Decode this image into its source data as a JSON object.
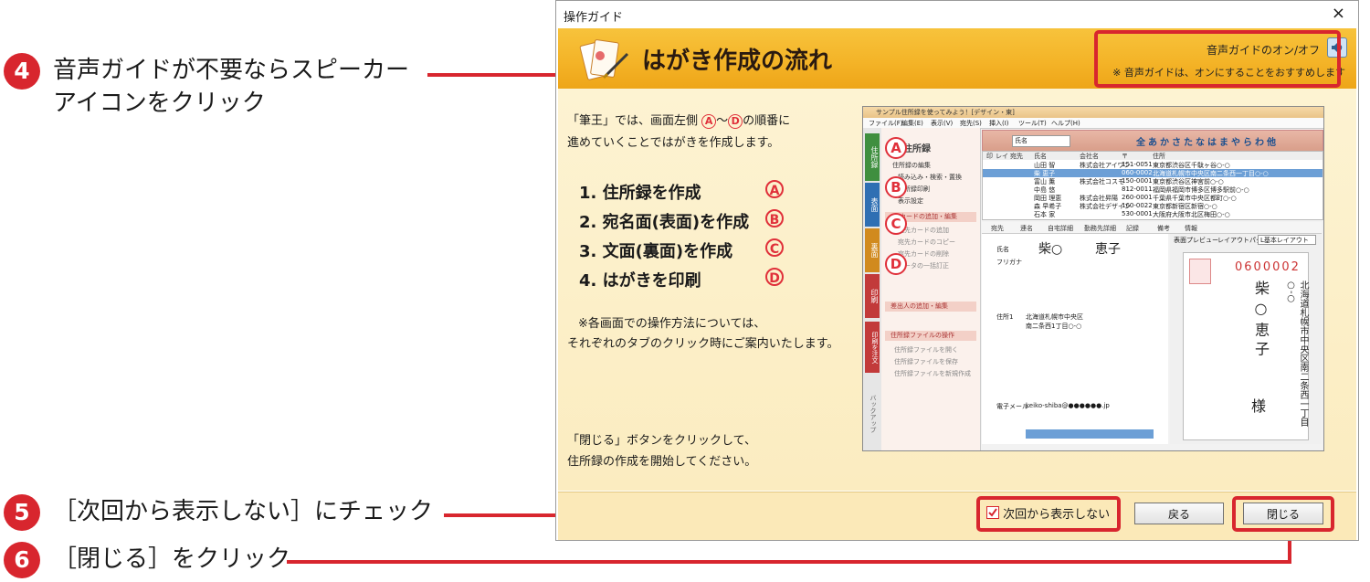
{
  "annotations": {
    "a4": {
      "num": "4",
      "line1": "音声ガイドが不要ならスピーカー",
      "line2": "アイコンをクリック"
    },
    "a5": {
      "num": "5",
      "text": "［次回から表示しない］にチェック"
    },
    "a6": {
      "num": "6",
      "text": "［閉じる］をクリック"
    }
  },
  "dialog": {
    "title": "操作ガイド",
    "close_glyph": "×",
    "banner_title": "はがき作成の流れ",
    "voice": {
      "label": "音声ガイドのオン/オフ",
      "note": "※ 音声ガイドは、オンにすることをおすすめします"
    },
    "intro": {
      "pre": "「筆王」では、画面左側",
      "a": "A",
      "tilde": "～",
      "d": "D",
      "post": "の順番に",
      "line2": "進めていくことではがきを作成します。"
    },
    "steps": [
      {
        "text": "1. 住所録を作成",
        "letter": "A"
      },
      {
        "text": "2. 宛名面(表面)を作成",
        "letter": "B"
      },
      {
        "text": "3. 文面(裏面)を作成",
        "letter": "C"
      },
      {
        "text": "4. はがきを印刷",
        "letter": "D"
      }
    ],
    "note1": "※各画面での操作方法については、",
    "note2": "それぞれのタブのクリック時にご案内いたします。",
    "closing1": "「閉じる」ボタンをクリックして、",
    "closing2": "住所録の作成を開始してください。",
    "checkbox_label": "次回から表示しない",
    "checkbox_checked": true,
    "back_button": "戻る",
    "close_button": "閉じる"
  },
  "screenshot": {
    "title": "サンプル住所録を使ってみよう！[デザイン・東]",
    "menu": [
      "ファイル(F)",
      "編集(E)",
      "表示(V)",
      "宛先(S)",
      "挿入(I)",
      "ツール(T)",
      "ヘルプ(H)"
    ],
    "side_tabs": [
      "住所録",
      "表面",
      "裏面",
      "印刷",
      "印刷を注文"
    ],
    "side_bottom": "バックアップ",
    "panel_title": "住所録",
    "panel_items": [
      {
        "letter": "A",
        "label": "住所録の編集"
      },
      {
        "letter": "B",
        "label": "読み込み・検索・置換"
      },
      {
        "letter": "",
        "label": "住所録印刷"
      },
      {
        "letter": "",
        "label": "表示設定"
      },
      {
        "letter": "C",
        "label": "カードの追加・編集"
      },
      {
        "letter": "",
        "label": "宛先カードの追加"
      },
      {
        "letter": "",
        "label": "宛先カードのコピー"
      },
      {
        "letter": "D",
        "label": "宛先カードの削除"
      },
      {
        "letter": "",
        "label": "データの一括訂正"
      },
      {
        "letter": "",
        "label": "差出人の追加・編集"
      },
      {
        "letter": "",
        "label": "住所録ファイルの操作"
      },
      {
        "letter": "",
        "label": "住所録ファイルを開く"
      },
      {
        "letter": "",
        "label": "住所録ファイルを保存"
      },
      {
        "letter": "",
        "label": "住所録ファイルを新規作成"
      }
    ],
    "kana_index": [
      "全",
      "あ",
      "か",
      "さ",
      "た",
      "な",
      "は",
      "ま",
      "や",
      "ら",
      "わ",
      "他"
    ],
    "search_field": "氏名",
    "table_headers": [
      "印",
      "レイ",
      "宛先",
      "氏名",
      "会社名",
      "〒",
      "住所"
    ],
    "rows": [
      {
        "name": "山田 智",
        "company": "株式会社アイワン",
        "zip": "151-0051",
        "addr": "東京都渋谷区千駄ヶ谷○-○"
      },
      {
        "name": "柴 恵子",
        "company": "",
        "zip": "060-0002",
        "addr": "北海道札幌市中央区南二条西一丁目○-○"
      },
      {
        "name": "富山 薫",
        "company": "株式会社コスモ",
        "zip": "150-0001",
        "addr": "東京都渋谷区神宮前○-○"
      },
      {
        "name": "中島 悠",
        "company": "",
        "zip": "812-0011",
        "addr": "福岡県福岡市博多区博多駅前○-○"
      },
      {
        "name": "岡田 理恵",
        "company": "株式会社昇陽",
        "zip": "260-0001",
        "addr": "千葉県千葉市中央区都町○-○"
      },
      {
        "name": "森 早希子",
        "company": "株式会社デザイン",
        "zip": "160-0022",
        "addr": "東京都新宿区新宿○-○"
      },
      {
        "name": "石本 家",
        "company": "",
        "zip": "530-0001",
        "addr": "大阪府大阪市北区梅田○-○"
      }
    ],
    "form_tabs": [
      "宛先",
      "連名",
      "自宅詳細",
      "勤務先詳細",
      "記録",
      "備考",
      "情報"
    ],
    "form": {
      "name_label": "氏名",
      "sei": "柴○",
      "mei": "恵子",
      "kana_label": "フリガナ",
      "address_label": "住所1",
      "address": "北海道札幌市中央区",
      "address2": "南二条西1丁目○-○",
      "email_label": "電子メール",
      "email": "keiko-shiba@●●●●●●.jp"
    },
    "preview_label": "表面プレビュー",
    "layout_label": "レイアウトパターン",
    "layout_value": "L基本レイアウト",
    "postcard": {
      "zip": "0600002",
      "addr": "北海道札幌市中央区南二条西一丁目○-○",
      "name": "柴 ○ 恵 子",
      "honor": "様"
    }
  }
}
